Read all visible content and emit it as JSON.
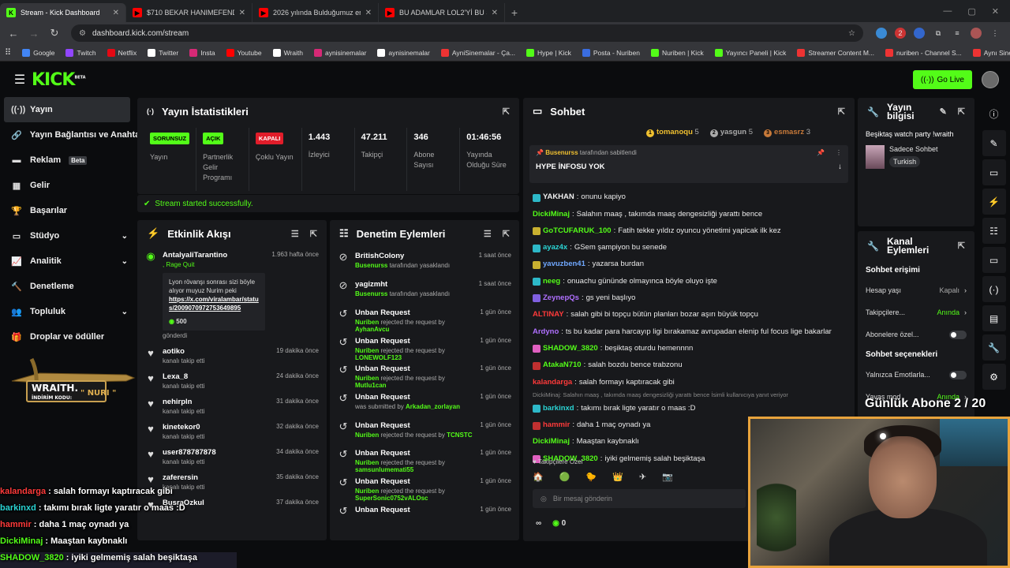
{
  "browser": {
    "tabs": [
      {
        "title": "Stream - Kick Dashboard",
        "favicon": "kick",
        "color": "#53fc18",
        "active": true
      },
      {
        "title": "$710 BEKAR HANIMEFENDİNİN",
        "favicon": "youtube",
        "color": "#ff0000",
        "active": false
      },
      {
        "title": "2026 yılında Bulduğumuz en iyi",
        "favicon": "youtube",
        "color": "#ff0000",
        "active": false
      },
      {
        "title": "BU ADAMLAR LOL2'Yİ BU SEFER",
        "favicon": "youtube",
        "color": "#ff0000",
        "active": false
      }
    ],
    "url": "dashboard.kick.com/stream",
    "bookmarks": [
      "Google",
      "Twitch",
      "Netflix",
      "Twitter",
      "Insta",
      "Youtube",
      "Wraith",
      "aynisinemalar",
      "aynisinemalar",
      "AyniSinemalar - Ça...",
      "Hype | Kick",
      "Posta - Nuriben",
      "Nuriben | Kick",
      "Yayıncı Paneli | Kick",
      "Streamer Content M...",
      "nuriben - Channel S...",
      "Aynı Sinemalar - Ça..."
    ]
  },
  "header": {
    "logo": "KICK",
    "logo_sup": "BETA",
    "go_live": "Go Live"
  },
  "sidebar": {
    "items": [
      {
        "label": "Yayın",
        "icon": "broadcast-icon",
        "glyph": "((·))",
        "active": true
      },
      {
        "label": "Yayın Bağlantısı ve Anahtarı",
        "icon": "link-icon",
        "glyph": "🔗"
      },
      {
        "label": "Reklam",
        "icon": "ad-icon",
        "glyph": "▬",
        "badge": "Beta"
      },
      {
        "label": "Gelir",
        "icon": "revenue-icon",
        "glyph": "▦"
      },
      {
        "label": "Başarılar",
        "icon": "trophy-icon",
        "glyph": "🏆"
      },
      {
        "label": "Stüdyo",
        "icon": "studio-icon",
        "glyph": "▭",
        "chev": true
      },
      {
        "label": "Analitik",
        "icon": "analytics-icon",
        "glyph": "📈",
        "chev": true
      },
      {
        "label": "Denetleme",
        "icon": "moderation-icon",
        "glyph": "🔨"
      },
      {
        "label": "Topluluk",
        "icon": "community-icon",
        "glyph": "👥",
        "chev": true
      },
      {
        "label": "Droplar ve ödüller",
        "icon": "drops-icon",
        "glyph": "🎁"
      }
    ]
  },
  "wraith_promo": {
    "brand": "WRAITH.",
    "code_label": "İNDİRİM KODU:",
    "code": "\" NURI \""
  },
  "stats": {
    "title": "Yayın İstatistikleri",
    "cols": [
      {
        "badge": "SORUNSUZ",
        "label": "Yayın",
        "style": "green"
      },
      {
        "badge": "AÇIK",
        "label": "Partnerlik Gelir Programı",
        "style": "green"
      },
      {
        "badge": "KAPALI",
        "label": "Çoklu Yayın",
        "style": "red"
      },
      {
        "value": "1.443",
        "label": "İzleyici"
      },
      {
        "value": "47.211",
        "label": "Takipçi"
      },
      {
        "value": "346",
        "label": "Abone Sayısı"
      },
      {
        "value": "01:46:56",
        "label": "Yayında Olduğu Süre"
      }
    ],
    "status": "Stream started successfully."
  },
  "activity": {
    "title": "Etkinlik Akışı",
    "first": {
      "user": "AntalyaliTarantino",
      "time": "1.963 hafta önce",
      "action": ", Rage Quit",
      "quote": "Lyon rövanşı sonrası sizi böyle alıyor muyuz Nurim peki",
      "link": "https://x.com/viralambar/status/2009070972753649895",
      "amount": "500",
      "sent": "gönderdi"
    },
    "items": [
      {
        "user": "aotiko",
        "time": "19 dakika önce",
        "sub": "kanalı takip etti"
      },
      {
        "user": "Lexa_8",
        "time": "24 dakika önce",
        "sub": "kanalı takip etti"
      },
      {
        "user": "nehirpln",
        "time": "31 dakika önce",
        "sub": "kanalı takip etti"
      },
      {
        "user": "kinetekor0",
        "time": "32 dakika önce",
        "sub": "kanalı takip etti"
      },
      {
        "user": "user878787878",
        "time": "34 dakika önce",
        "sub": "kanalı takip etti"
      },
      {
        "user": "zaferersin",
        "time": "35 dakika önce",
        "sub": "kanalı takip etti"
      },
      {
        "user": "BusraOzkul",
        "time": "37 dakika önce",
        "sub": ""
      }
    ]
  },
  "moderation": {
    "title": "Denetim Eylemleri",
    "items": [
      {
        "user": "BritishColony",
        "time": "1 saat önce",
        "by": "Busenurss",
        "text": " tarafından yasaklandı",
        "icon": "ban-icon",
        "target": ""
      },
      {
        "user": "yagizmht",
        "time": "1 saat önce",
        "by": "Busenurss",
        "text": " tarafından yasaklandı",
        "icon": "ban-icon",
        "target": ""
      },
      {
        "user": "Unban Request",
        "time": "1 gün önce",
        "by": "Nuriben",
        "text": " rejected the request by ",
        "target": "AyhanAvcu",
        "icon": "history-icon"
      },
      {
        "user": "Unban Request",
        "time": "1 gün önce",
        "by": "Nuriben",
        "text": " rejected the request by ",
        "target": "LONEWOLF123",
        "icon": "history-icon"
      },
      {
        "user": "Unban Request",
        "time": "1 gün önce",
        "by": "Nuriben",
        "text": " rejected the request by ",
        "target": "Mutlu1can",
        "icon": "history-icon"
      },
      {
        "user": "Unban Request",
        "time": "1 gün önce",
        "by": "",
        "text": "was submitted by ",
        "target": "Arkadan_zorlayan",
        "icon": "history-icon"
      },
      {
        "user": "Unban Request",
        "time": "1 gün önce",
        "by": "Nuriben",
        "text": " rejected the request by ",
        "target": "TCNSTC",
        "icon": "history-icon"
      },
      {
        "user": "Unban Request",
        "time": "1 gün önce",
        "by": "Nuriben",
        "text": " rejected the request by ",
        "target": "samsunlumemati55",
        "icon": "history-icon"
      },
      {
        "user": "Unban Request",
        "time": "1 gün önce",
        "by": "Nuriben",
        "text": " rejected the request by ",
        "target": "SuperSonic0752vALOsc",
        "icon": "history-icon"
      },
      {
        "user": "Unban Request",
        "time": "1 gün önce",
        "by": "",
        "text": "",
        "target": "",
        "icon": "history-icon"
      }
    ]
  },
  "chat": {
    "title": "Sohbet",
    "top_gifters": [
      {
        "rank": "1",
        "name": "tomanoqu",
        "count": "5"
      },
      {
        "rank": "2",
        "name": "yasgun",
        "count": "5"
      },
      {
        "rank": "3",
        "name": "esmasrz",
        "count": "3"
      }
    ],
    "pinned": {
      "by": "Busenurss",
      "by_suffix": " tarafından sabitlendi",
      "message": "HYPE İNFOSU YOK"
    },
    "lines": [
      {
        "user": "YAKHAN",
        "color": "#f0f0f0",
        "text": "onunu kapiyo",
        "badge": "#2db8c8"
      },
      {
        "user": "DickiMinaj",
        "color": "#53fc18",
        "text": "Salahın maaş , takımda maaş dengesizliği yarattı bence",
        "badge": ""
      },
      {
        "user": "GoTCUFARUK_100",
        "color": "#53fc18",
        "text": "Fatih tekke yıldız oyuncu yönetimi yapicak ilk kez",
        "badge": "#c8b030"
      },
      {
        "user": "ayaz4x",
        "color": "#2ad4d4",
        "text": "GSem şampiyon bu senede",
        "badge": "#2db8c8"
      },
      {
        "user": "yavuzben41",
        "color": "#70a8ff",
        "text": "yazarsa burdan",
        "badge": "#c8b030"
      },
      {
        "user": "neeg",
        "color": "#53fc18",
        "text": "onuachu gününde olmayınca böyle oluyo işte",
        "badge": "#2db8c8"
      },
      {
        "user": "ZeynepQs",
        "color": "#b070ff",
        "text": "gs yeni başlıyo",
        "badge": "#8060e0"
      },
      {
        "user": "ALTINAY",
        "color": "#ff3a3a",
        "text": "salah gibi bi topçu bütün planları bozar aşırı büyük topçu",
        "badge": ""
      },
      {
        "user": "Ardyno",
        "color": "#b070ff",
        "text": "ts bu kadar para harcayıp ligi bırakamaz avrupadan elenip ful focus lige bakarlar",
        "badge": ""
      },
      {
        "user": "SHADOW_3820",
        "color": "#53fc18",
        "text": "beşiktaş oturdu hemennnn",
        "badge": "#e060c0"
      },
      {
        "user": "AtakaN710",
        "color": "#53fc18",
        "text": "salah bozdu bence trabzonu",
        "badge": "#c03030"
      },
      {
        "user": "kalandarga",
        "color": "#ff3a3a",
        "text": "salah formayı kaptıracak gibi",
        "badge": ""
      },
      {
        "reply": "DickiMinaj: Salahın maaş , takımda maaş dengesizliği yarattı bence İsimli kullanıcıya yanıt veriyor"
      },
      {
        "user": "barkinxd",
        "color": "#2ad4d4",
        "text": "takımı bırak ligte yaratır o maas :D",
        "badge": "#2db8c8"
      },
      {
        "user": "hammir",
        "color": "#ff3a3a",
        "text": "daha 1 maç oynadı ya",
        "badge": "#c03030"
      },
      {
        "user": "DickiMinaj",
        "color": "#53fc18",
        "text": "Maaştan kaybnaklı",
        "badge": ""
      },
      {
        "user": "SHADOW_3820",
        "color": "#53fc18",
        "text": "iyiki gelmemiş salah beşiktaşa",
        "badge": "#e060c0"
      }
    ],
    "follow_label": "Takipçilere Özel",
    "input_placeholder": "Bir mesaj gönderin",
    "footer_count": "0"
  },
  "stream_info": {
    "title": "Yayın bilgisi",
    "stream_title": "Beşiktaş watch party !wraith",
    "category": "Sadece Sohbet",
    "tag": "Turkish"
  },
  "channel_actions": {
    "title": "Kanal Eylemleri",
    "section1": "Sohbet erişimi",
    "rows": [
      {
        "label": "Hesap yaşı",
        "value": "Kapalı",
        "kind": "nav"
      },
      {
        "label": "Takipçilere...",
        "value": "Anında",
        "kind": "nav",
        "green": true
      },
      {
        "label": "Abonelere özel...",
        "kind": "toggle"
      }
    ],
    "section2": "Sohbet seçenekleri",
    "rows2": [
      {
        "label": "Yalnızca Emotlarla...",
        "kind": "toggle"
      },
      {
        "label": "Yavaş mod",
        "value": "Anında",
        "kind": "nav",
        "green": true
      }
    ]
  },
  "overlay": {
    "lines": [
      {
        "user": "kalandarga",
        "color": "#ff3a3a",
        "text": " : salah formayı kaptıracak gibi"
      },
      {
        "user": "barkinxd",
        "color": "#2ad4d4",
        "text": " : takımı bırak ligte yaratır o maas :D"
      },
      {
        "user": "hammir",
        "color": "#ff3a3a",
        "text": " : daha 1 maç oynadı ya"
      },
      {
        "user": "DickiMinaj",
        "color": "#53fc18",
        "text": " : Maaştan kaybnaklı"
      },
      {
        "user": "SHADOW_3820",
        "color": "#53fc18",
        "text": " : iyiki gelmemiş salah beşiktaşa"
      }
    ],
    "sub_goal": "Günlük Abone 2 / 20"
  }
}
